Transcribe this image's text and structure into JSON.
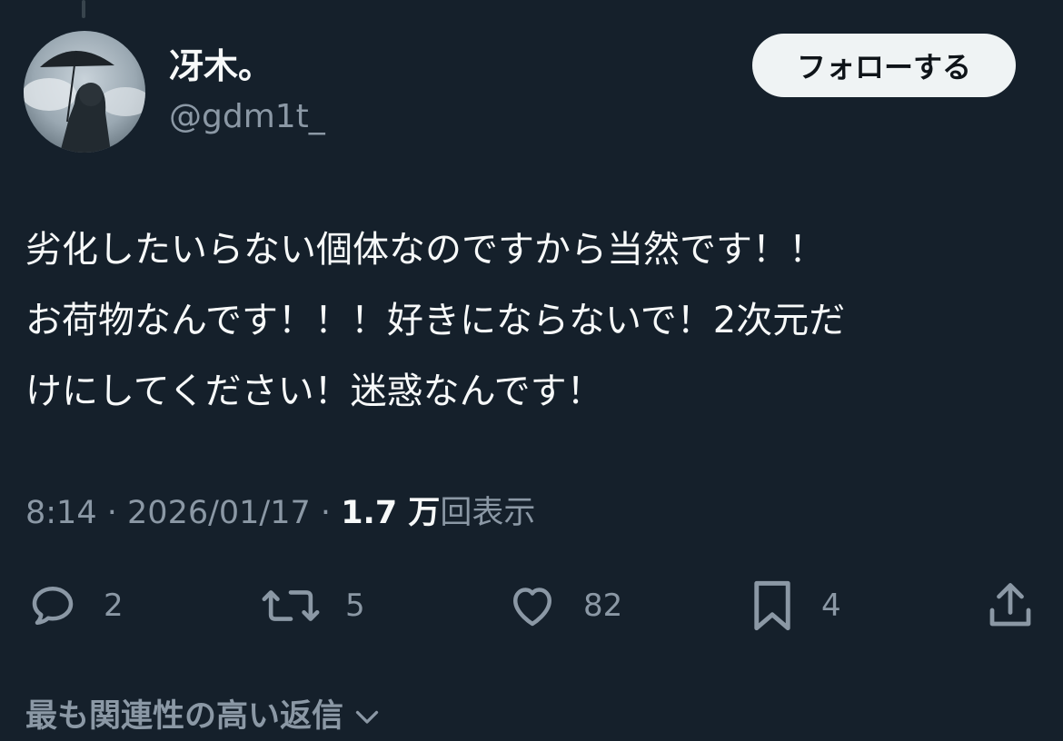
{
  "author": {
    "display_name": "冴木。",
    "handle": "@gdm1t_"
  },
  "follow_button_label": "フォローする",
  "tweet": {
    "lines": [
      "劣化したいらない個体なのですから当然です！！",
      "お荷物なんです！！！好きにならないで！2次元だ",
      "けにしてください！迷惑なんです！"
    ]
  },
  "meta": {
    "time": "8:14",
    "separator": "·",
    "date": "2026/01/17",
    "views_count": "1.7 万",
    "views_label": "回表示"
  },
  "actions": {
    "reply": {
      "icon": "reply-icon",
      "count": "2"
    },
    "repost": {
      "icon": "repost-icon",
      "count": "5"
    },
    "like": {
      "icon": "heart-icon",
      "count": "82"
    },
    "bookmark": {
      "icon": "bookmark-icon",
      "count": "4"
    },
    "share": {
      "icon": "share-icon"
    }
  },
  "replies_sort": {
    "label": "最も関連性の高い返信",
    "icon": "chevron-down-icon"
  },
  "colors": {
    "background": "#15202b",
    "text_primary": "#f7f9f9",
    "text_secondary": "#8b98a5",
    "button_bg": "#eff3f4"
  }
}
